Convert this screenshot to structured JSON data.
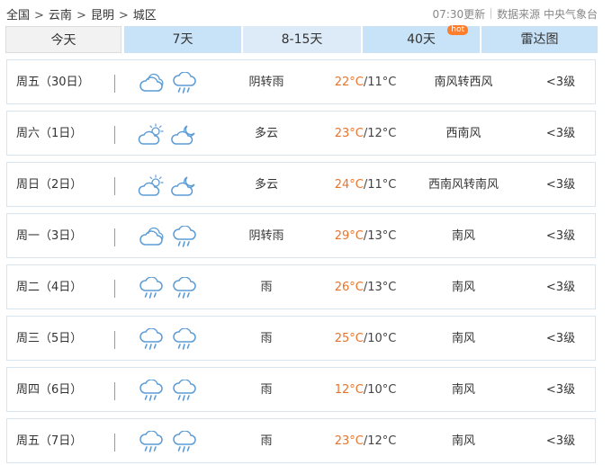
{
  "breadcrumb": {
    "items": [
      "全国",
      "云南",
      "昆明",
      "城区"
    ],
    "separator": ">"
  },
  "update": {
    "time": "07:30更新",
    "source_label": "数据来源",
    "source": "中央气象台"
  },
  "tabs": [
    {
      "label": "今天"
    },
    {
      "label": "7天"
    },
    {
      "label": "8-15天"
    },
    {
      "label": "40天",
      "badge": "hot"
    },
    {
      "label": "雷达图"
    }
  ],
  "colors": {
    "high_temp": "#e8742b",
    "tab_active": "#c8e3f7",
    "badge": "#ff7d2b",
    "icon_stroke": "#5b9bd5"
  },
  "forecast": [
    {
      "day": "周五（30日）",
      "icon_day": "overcast-icon",
      "icon_night": "rain-icon",
      "weather": "阴转雨",
      "high": "22°C",
      "low": "/11°C",
      "wind": "南风转西风",
      "level": "<3级"
    },
    {
      "day": "周六（1日）",
      "icon_day": "partly-cloudy-day-icon",
      "icon_night": "partly-cloudy-night-icon",
      "weather": "多云",
      "high": "23°C",
      "low": "/12°C",
      "wind": "西南风",
      "level": "<3级"
    },
    {
      "day": "周日（2日）",
      "icon_day": "partly-cloudy-day-icon",
      "icon_night": "partly-cloudy-night-icon",
      "weather": "多云",
      "high": "24°C",
      "low": "/11°C",
      "wind": "西南风转南风",
      "level": "<3级"
    },
    {
      "day": "周一（3日）",
      "icon_day": "overcast-icon",
      "icon_night": "rain-icon",
      "weather": "阴转雨",
      "high": "29°C",
      "low": "/13°C",
      "wind": "南风",
      "level": "<3级"
    },
    {
      "day": "周二（4日）",
      "icon_day": "rain-icon",
      "icon_night": "rain-icon",
      "weather": "雨",
      "high": "26°C",
      "low": "/13°C",
      "wind": "南风",
      "level": "<3级"
    },
    {
      "day": "周三（5日）",
      "icon_day": "rain-icon",
      "icon_night": "rain-icon",
      "weather": "雨",
      "high": "25°C",
      "low": "/10°C",
      "wind": "南风",
      "level": "<3级"
    },
    {
      "day": "周四（6日）",
      "icon_day": "rain-icon",
      "icon_night": "rain-icon",
      "weather": "雨",
      "high": "12°C",
      "low": "/10°C",
      "wind": "南风",
      "level": "<3级"
    },
    {
      "day": "周五（7日）",
      "icon_day": "rain-icon",
      "icon_night": "rain-icon",
      "weather": "雨",
      "high": "23°C",
      "low": "/12°C",
      "wind": "南风",
      "level": "<3级"
    }
  ]
}
